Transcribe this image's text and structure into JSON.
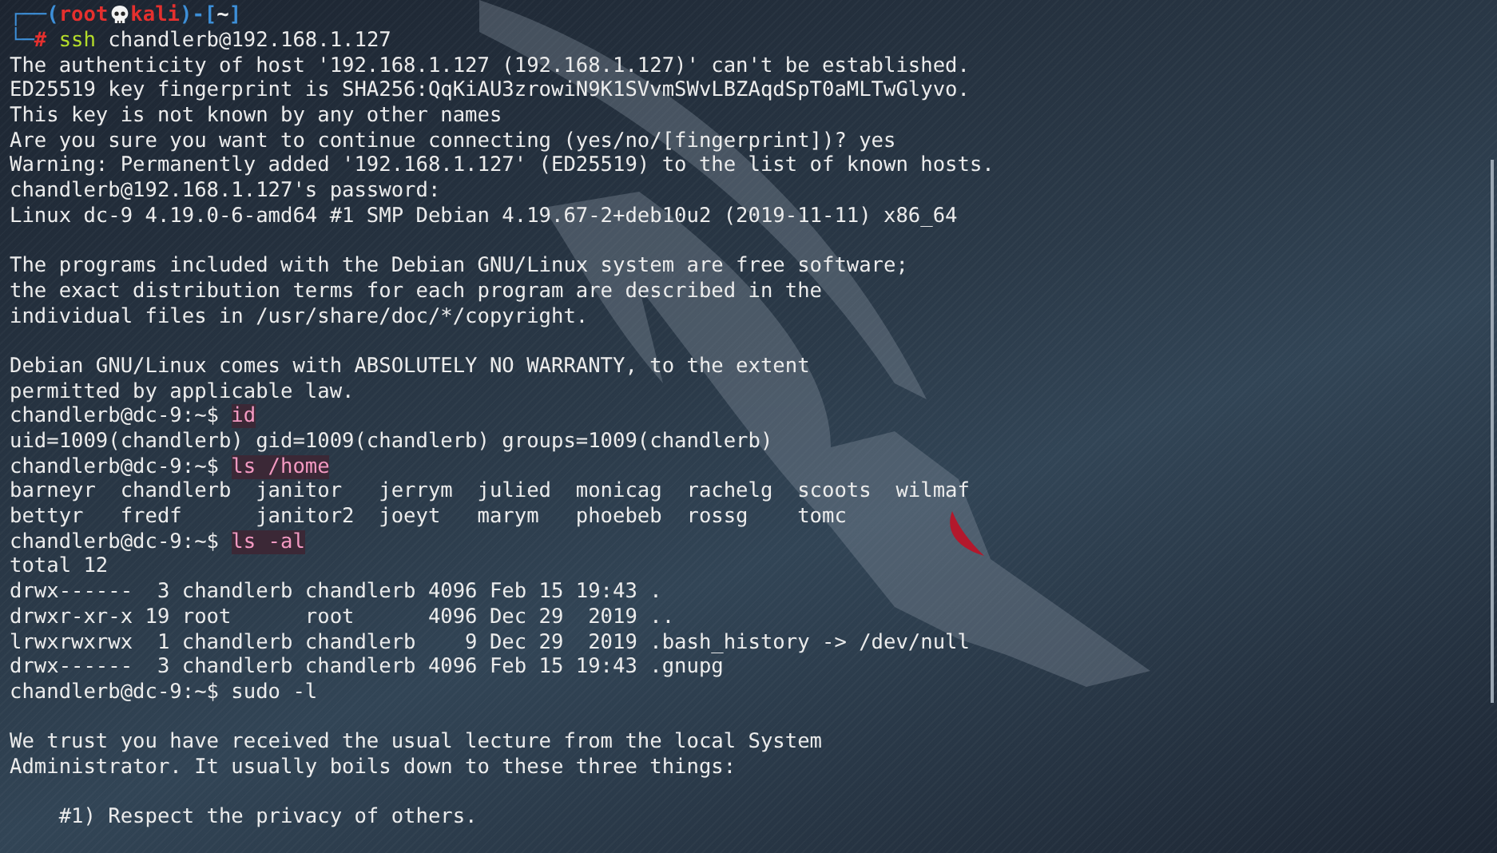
{
  "terminal": {
    "lines": [
      {
        "kind": "header",
        "frame_open": "┌──(",
        "user": "root",
        "host": "kali",
        "frame_mid": ")-[",
        "path": "~",
        "frame_close": "]"
      },
      {
        "kind": "root_command",
        "frame": "└─",
        "symbol": "#",
        "program": "ssh",
        "args": "chandlerb@192.168.1.127"
      },
      {
        "kind": "output",
        "text": "The authenticity of host '192.168.1.127 (192.168.1.127)' can't be established."
      },
      {
        "kind": "output",
        "text": "ED25519 key fingerprint is SHA256:QqKiAU3zrowiN9K1SVvmSWvLBZAqdSpT0aMLTwGlyvo."
      },
      {
        "kind": "output",
        "text": "This key is not known by any other names"
      },
      {
        "kind": "output",
        "text": "Are you sure you want to continue connecting (yes/no/[fingerprint])? yes"
      },
      {
        "kind": "output",
        "text": "Warning: Permanently added '192.168.1.127' (ED25519) to the list of known hosts."
      },
      {
        "kind": "output",
        "text": "chandlerb@192.168.1.127's password:"
      },
      {
        "kind": "output",
        "text": "Linux dc-9 4.19.0-6-amd64 #1 SMP Debian 4.19.67-2+deb10u2 (2019-11-11) x86_64"
      },
      {
        "kind": "blank"
      },
      {
        "kind": "output",
        "text": "The programs included with the Debian GNU/Linux system are free software;"
      },
      {
        "kind": "output",
        "text": "the exact distribution terms for each program are described in the"
      },
      {
        "kind": "output",
        "text": "individual files in /usr/share/doc/*/copyright."
      },
      {
        "kind": "blank"
      },
      {
        "kind": "output",
        "text": "Debian GNU/Linux comes with ABSOLUTELY NO WARRANTY, to the extent"
      },
      {
        "kind": "output",
        "text": "permitted by applicable law."
      },
      {
        "kind": "user_command",
        "prompt": "chandlerb@dc-9:~$",
        "command": "id",
        "highlighted": true
      },
      {
        "kind": "output",
        "text": "uid=1009(chandlerb) gid=1009(chandlerb) groups=1009(chandlerb)"
      },
      {
        "kind": "user_command",
        "prompt": "chandlerb@dc-9:~$",
        "command": "ls /home",
        "highlighted": true
      },
      {
        "kind": "output",
        "text": "barneyr  chandlerb  janitor   jerrym  julied  monicag  rachelg  scoots  wilmaf"
      },
      {
        "kind": "output",
        "text": "bettyr   fredf      janitor2  joeyt   marym   phoebeb  rossg    tomc"
      },
      {
        "kind": "user_command",
        "prompt": "chandlerb@dc-9:~$",
        "command": "ls -al",
        "highlighted": true
      },
      {
        "kind": "output",
        "text": "total 12"
      },
      {
        "kind": "output",
        "text": "drwx------  3 chandlerb chandlerb 4096 Feb 15 19:43 ."
      },
      {
        "kind": "output",
        "text": "drwxr-xr-x 19 root      root      4096 Dec 29  2019 .."
      },
      {
        "kind": "output",
        "text": "lrwxrwxrwx  1 chandlerb chandlerb    9 Dec 29  2019 .bash_history -> /dev/null"
      },
      {
        "kind": "output",
        "text": "drwx------  3 chandlerb chandlerb 4096 Feb 15 19:43 .gnupg"
      },
      {
        "kind": "user_command",
        "prompt": "chandlerb@dc-9:~$",
        "command": "sudo -l",
        "highlighted": false
      },
      {
        "kind": "blank"
      },
      {
        "kind": "output",
        "text": "We trust you have received the usual lecture from the local System"
      },
      {
        "kind": "output",
        "text": "Administrator. It usually boils down to these three things:"
      },
      {
        "kind": "blank"
      },
      {
        "kind": "output",
        "text": "    #1) Respect the privacy of others."
      }
    ]
  }
}
